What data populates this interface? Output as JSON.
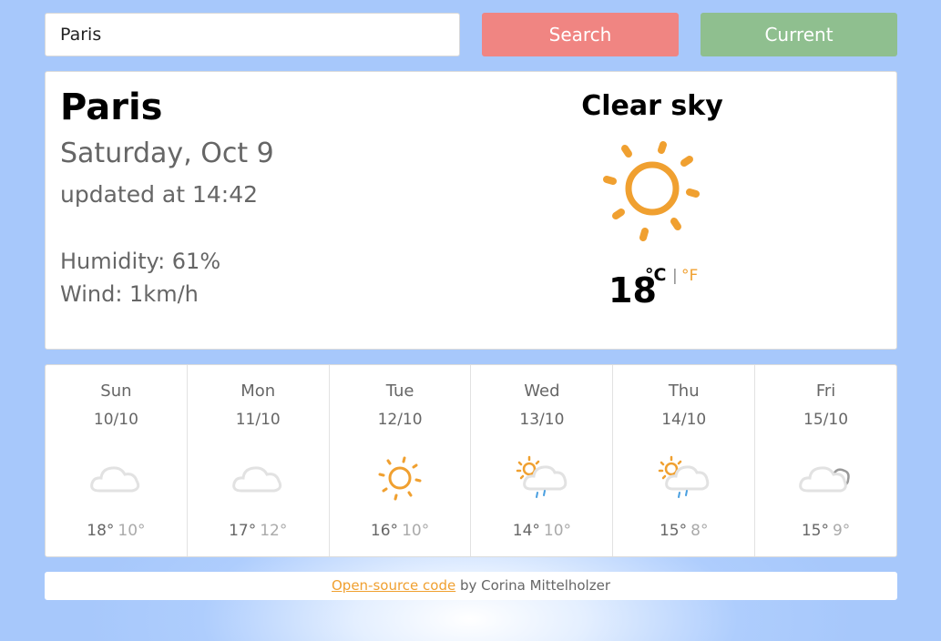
{
  "search": {
    "value": "Paris",
    "search_label": "Search",
    "current_label": "Current"
  },
  "current": {
    "city": "Paris",
    "date": "Saturday, Oct 9",
    "updated": "updated at 14:42",
    "humidity": "Humidity: 61%",
    "wind": "Wind: 1km/h",
    "description": "Clear sky",
    "icon": "sun-icon",
    "temperature": "18",
    "unit_c": "°C",
    "unit_sep": "|",
    "unit_f": "°F"
  },
  "forecast": [
    {
      "day": "Sun",
      "date": "10/10",
      "icon": "cloud-icon",
      "hi": "18°",
      "lo": "10°"
    },
    {
      "day": "Mon",
      "date": "11/10",
      "icon": "cloud-icon",
      "hi": "17°",
      "lo": "12°"
    },
    {
      "day": "Tue",
      "date": "12/10",
      "icon": "sun-icon",
      "hi": "16°",
      "lo": "10°"
    },
    {
      "day": "Wed",
      "date": "13/10",
      "icon": "sun-rain-cloud-icon",
      "hi": "14°",
      "lo": "10°"
    },
    {
      "day": "Thu",
      "date": "14/10",
      "icon": "sun-rain-cloud-icon",
      "hi": "15°",
      "lo": "8°"
    },
    {
      "day": "Fri",
      "date": "15/10",
      "icon": "clouds-icon",
      "hi": "15°",
      "lo": "9°"
    }
  ],
  "footer": {
    "link": "Open-source code",
    "text": " by Corina Mittelholzer"
  },
  "colors": {
    "accent": "#f0a030",
    "search_button": "#f08582",
    "current_button": "#8fbf8f",
    "background": "#a7c8fb"
  }
}
